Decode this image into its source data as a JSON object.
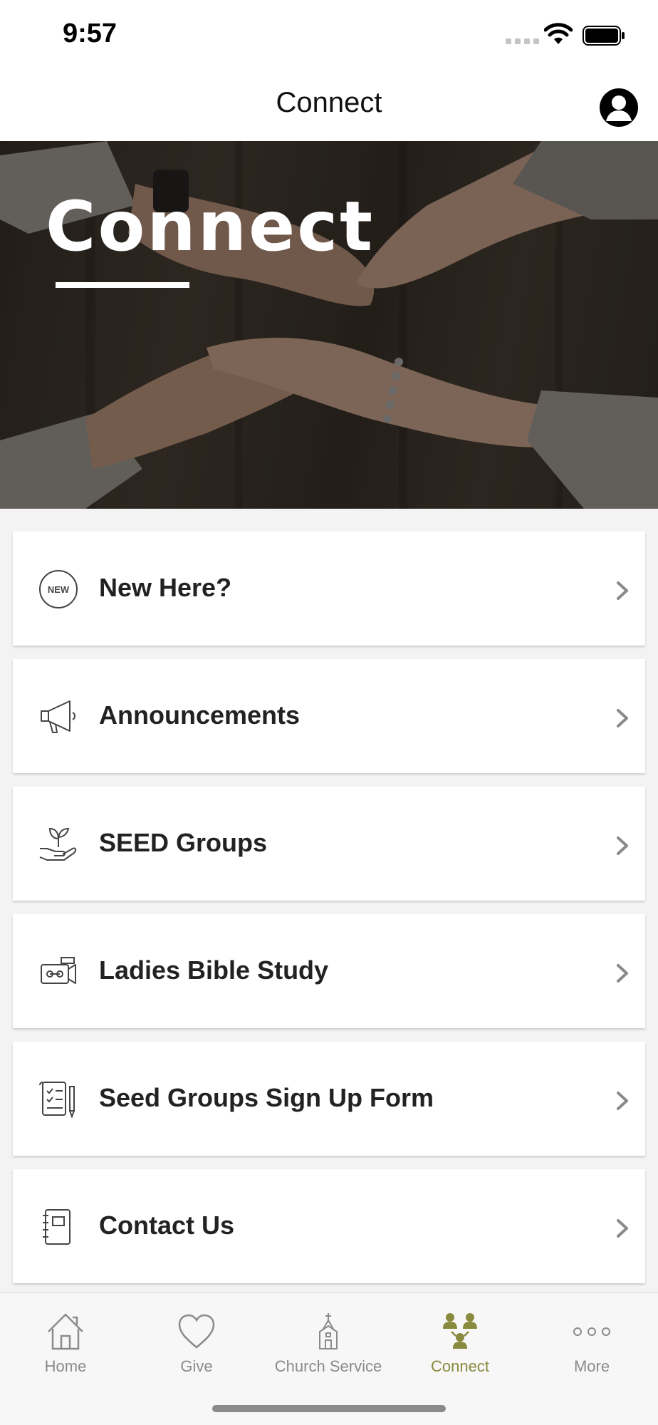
{
  "status_bar": {
    "time": "9:57"
  },
  "nav": {
    "title": "Connect"
  },
  "hero": {
    "title": "Connect"
  },
  "menu": [
    {
      "label": "New Here?",
      "icon": "new-badge-icon",
      "badge_text": "NEW"
    },
    {
      "label": "Announcements",
      "icon": "megaphone-icon"
    },
    {
      "label": "SEED Groups",
      "icon": "plant-hand-icon"
    },
    {
      "label": "Ladies Bible Study",
      "icon": "video-camera-icon"
    },
    {
      "label": "Seed Groups Sign Up Form",
      "icon": "form-icon"
    },
    {
      "label": "Contact Us",
      "icon": "contact-book-icon"
    }
  ],
  "tabs": [
    {
      "label": "Home",
      "icon": "home-icon",
      "active": false
    },
    {
      "label": "Give",
      "icon": "heart-icon",
      "active": false
    },
    {
      "label": "Church Service",
      "icon": "church-icon",
      "active": false
    },
    {
      "label": "Connect",
      "icon": "people-icon",
      "active": true
    },
    {
      "label": "More",
      "icon": "more-dots-icon",
      "active": false
    }
  ],
  "colors": {
    "accent": "#888a3e",
    "inactive": "#8b8b8b"
  }
}
